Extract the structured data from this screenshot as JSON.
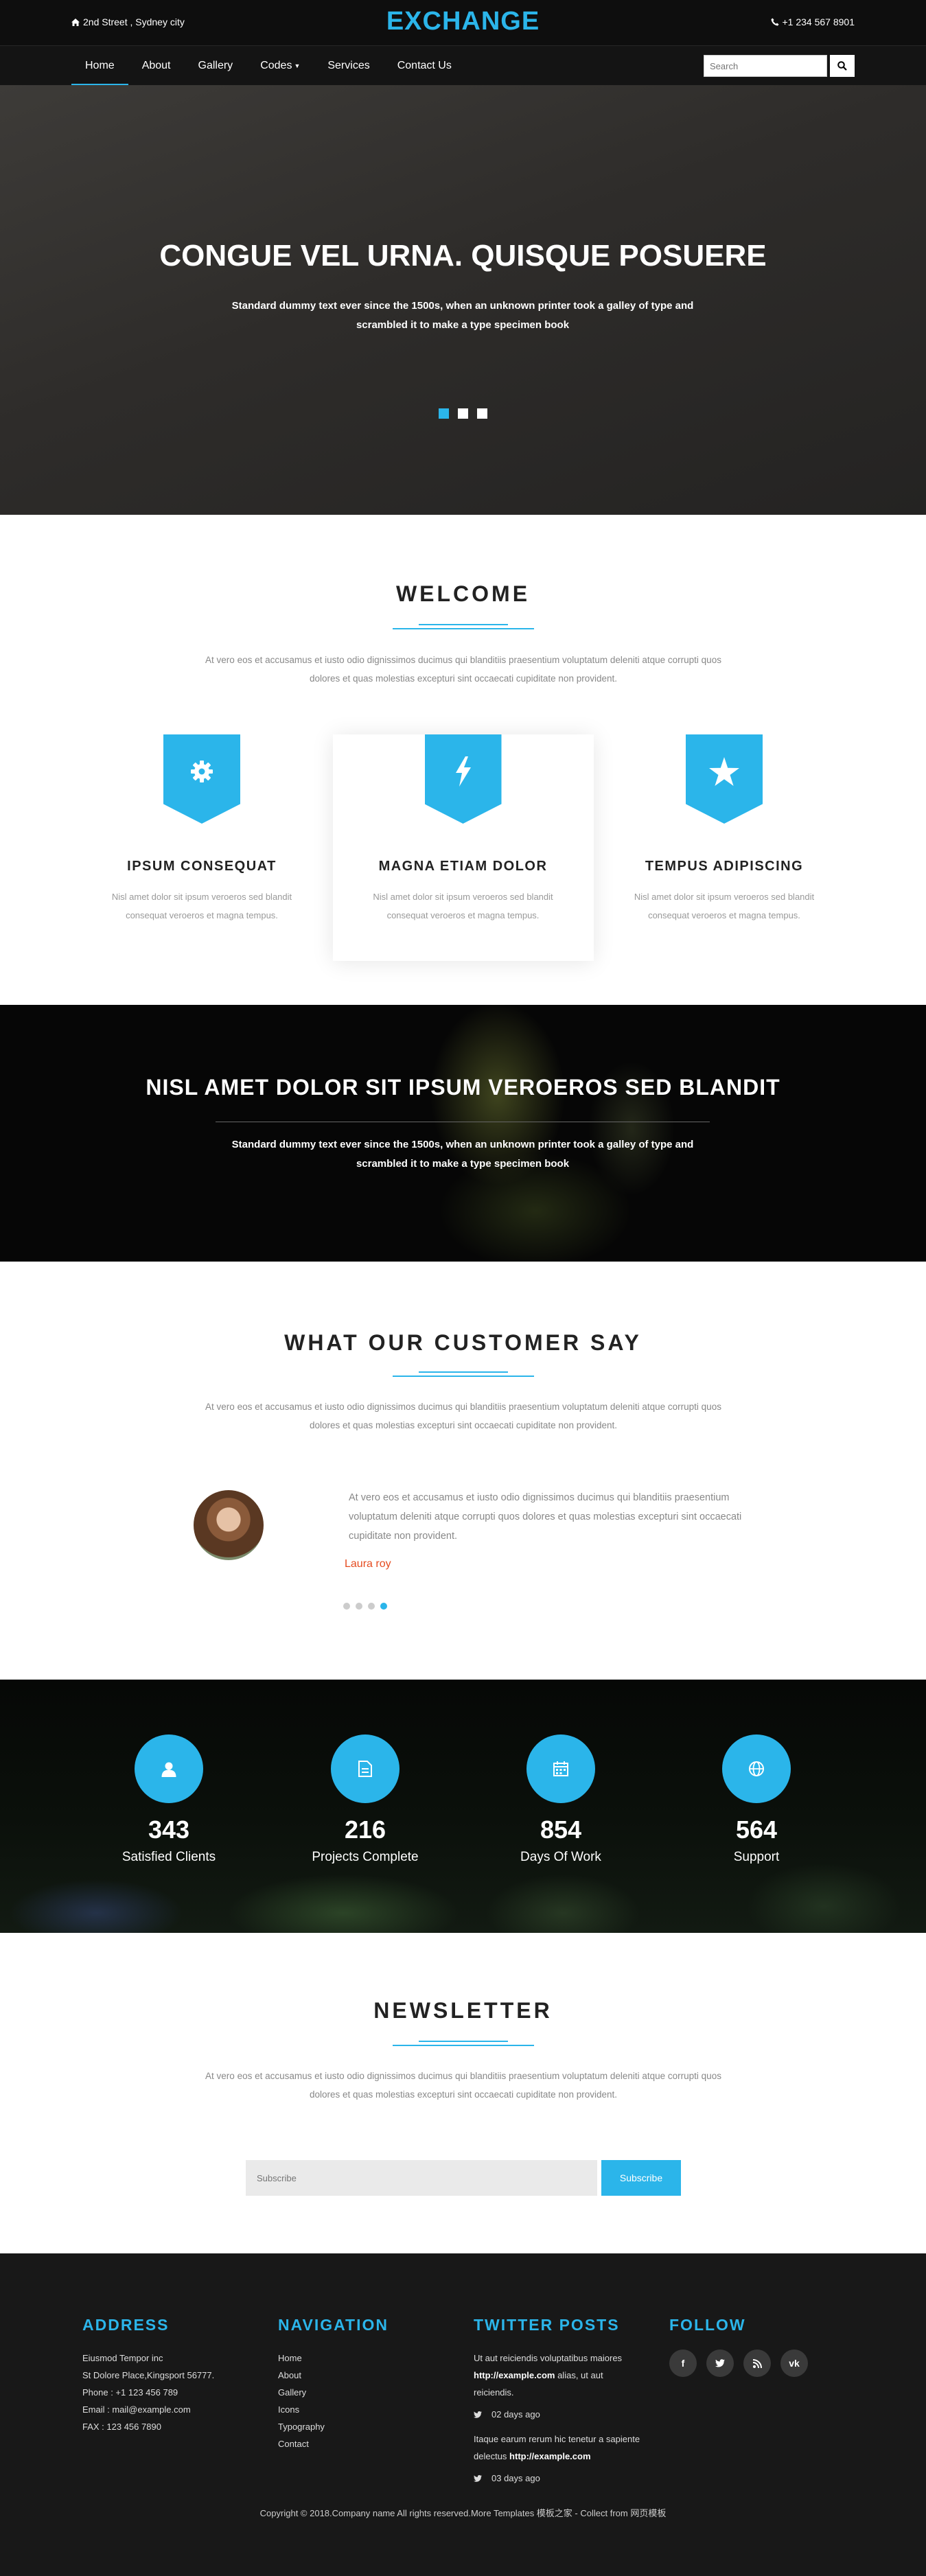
{
  "topbar": {
    "address": "2nd Street , Sydney city",
    "logo": "EXCHANGE",
    "phone": "+1 234 567 8901"
  },
  "nav": {
    "items": [
      "Home",
      "About",
      "Gallery",
      "Codes",
      "Services",
      "Contact Us"
    ],
    "active": "Home",
    "search_placeholder": "Search"
  },
  "hero": {
    "title": "CONGUE VEL URNA. QUISQUE POSUERE",
    "text": "Standard dummy text ever since the 1500s, when an unknown printer took a galley of type and scrambled it to make a type specimen book",
    "slides": 3,
    "active_slide": 1
  },
  "welcome": {
    "title": "WELCOME",
    "desc": "At vero eos et accusamus et iusto odio dignissimos ducimus qui blanditiis praesentium voluptatum deleniti atque corrupti quos dolores et quas molestias excepturi sint occaecati cupiditate non provident.",
    "features": [
      {
        "icon": "gear-icon",
        "title": "IPSUM CONSEQUAT",
        "text": "Nisl amet dolor sit ipsum veroeros sed blandit consequat veroeros et magna tempus."
      },
      {
        "icon": "bolt-icon",
        "title": "MAGNA ETIAM DOLOR",
        "text": "Nisl amet dolor sit ipsum veroeros sed blandit consequat veroeros et magna tempus."
      },
      {
        "icon": "star-icon",
        "title": "TEMPUS ADIPISCING",
        "text": "Nisl amet dolor sit ipsum veroeros sed blandit consequat veroeros et magna tempus."
      }
    ]
  },
  "banner": {
    "title": "NISL AMET DOLOR SIT IPSUM VEROEROS SED BLANDIT",
    "text": "Standard dummy text ever since the 1500s, when an unknown printer took a galley of type and scrambled it to make a type specimen book"
  },
  "testimonials": {
    "title": "WHAT OUR CUSTOMER SAY",
    "desc": "At vero eos et accusamus et iusto odio dignissimos ducimus qui blanditiis praesentium voluptatum deleniti atque corrupti quos dolores et quas molestias excepturi sint occaecati cupiditate non provident.",
    "quote": "At vero eos et accusamus et iusto odio dignissimos ducimus qui blanditiis praesentium voluptatum deleniti atque corrupti quos dolores et quas molestias excepturi sint occaecati cupiditate non provident.",
    "author": "Laura roy",
    "dots": 4,
    "active_dot": 4
  },
  "stats": [
    {
      "icon": "user-icon",
      "value": "343",
      "label": "Satisfied Clients"
    },
    {
      "icon": "document-icon",
      "value": "216",
      "label": "Projects Complete"
    },
    {
      "icon": "calendar-icon",
      "value": "854",
      "label": "Days Of Work"
    },
    {
      "icon": "globe-icon",
      "value": "564",
      "label": "Support"
    }
  ],
  "newsletter": {
    "title": "NEWSLETTER",
    "desc": "At vero eos et accusamus et iusto odio dignissimos ducimus qui blanditiis praesentium voluptatum deleniti atque corrupti quos dolores et quas molestias excepturi sint occaecati cupiditate non provident.",
    "placeholder": "Subscribe",
    "button": "Subscribe"
  },
  "footer": {
    "address": {
      "title": "ADDRESS",
      "lines": [
        "Eiusmod Tempor inc",
        "St Dolore Place,Kingsport 56777.",
        "Phone : +1 123 456 789",
        "Email : mail@example.com",
        "FAX : 123 456 7890"
      ]
    },
    "navigation": {
      "title": "NAVIGATION",
      "items": [
        "Home",
        "About",
        "Gallery",
        "Icons",
        "Typography",
        "Contact"
      ]
    },
    "twitter": {
      "title": "TWITTER POSTS",
      "posts": [
        {
          "pre": "Ut aut reiciendis voluptatibus maiores ",
          "link": "http://example.com",
          "post": " alias, ut aut reiciendis.",
          "time": "02 days ago"
        },
        {
          "pre": "Itaque earum rerum hic tenetur a sapiente delectus ",
          "link": "http://example.com",
          "post": "",
          "time": "03 days ago"
        }
      ]
    },
    "follow": {
      "title": "FOLLOW",
      "icons": [
        "facebook-icon",
        "twitter-icon",
        "rss-icon",
        "vk-icon"
      ]
    },
    "copyright": "Copyright © 2018.Company name All rights reserved.More Templates 模板之家 - Collect from 网页模板"
  },
  "colors": {
    "accent": "#2bb5ea",
    "author": "#e54b1f",
    "footer_bg": "#181818"
  }
}
